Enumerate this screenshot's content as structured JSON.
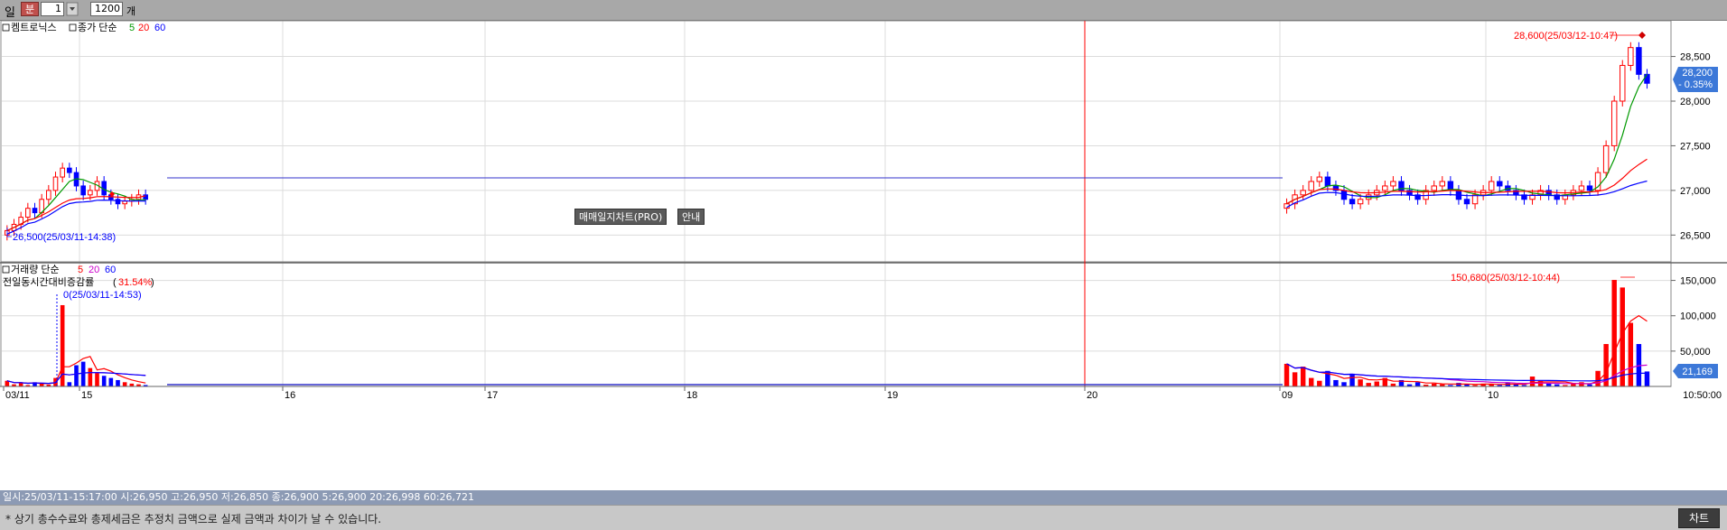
{
  "toolbar": {
    "period_day": "일",
    "period_minute": "분",
    "interval_value": "1",
    "count_value": "1200",
    "count_unit": "개"
  },
  "price_panel": {
    "stock_name": "켐트로닉스",
    "indicator_name": "종가 단순",
    "ma_periods": [
      "5",
      "20",
      "60"
    ],
    "high_marker": "28,600(25/03/12-10:47)",
    "low_marker": "26,500(25/03/11-14:38)",
    "current_price": "28,200",
    "current_change": "- 0.35%",
    "y_ticks": [
      "28,500",
      "28,000",
      "27,500",
      "27,000",
      "26,500"
    ]
  },
  "volume_panel": {
    "indicator_name": "거래량 단순",
    "ma_periods": [
      "5",
      "20",
      "60"
    ],
    "compare_label": "전일동시간대비증감률",
    "compare_value": "31.54%",
    "high_marker": "150,680(25/03/12-10:44)",
    "low_marker": "0(25/03/11-14:53)",
    "current_volume": "21,169",
    "y_ticks": [
      "150,000",
      "100,000",
      "50,000"
    ]
  },
  "x_axis": {
    "labels": [
      "03/11",
      "15",
      "16",
      "17",
      "18",
      "19",
      "20",
      "09",
      "10"
    ],
    "time_box": "10:50:00"
  },
  "overlay": {
    "chart_name": "매매일지차트(PRO)",
    "guide": "안내"
  },
  "status_bar": {
    "text": "일시:25/03/11-15:17:00 시:26,950 고:26,950 저:26,850 종:26,900 5:26,900 20:26,998 60:26,721"
  },
  "footer": {
    "notice": "* 상기 총수수료와 총제세금은 추정치 금액으로 실제 금액과 차이가 날 수 있습니다.",
    "chart_button": "차트"
  },
  "colors": {
    "up": "#ff0000",
    "down": "#0000ff",
    "ma5": "#009900",
    "ma20": "#ff0000",
    "ma60": "#0000ff",
    "price_badge": "#3c78d8"
  },
  "chart_data": [
    {
      "type": "candlestick",
      "series": [
        {
          "name": "5"
        },
        {
          "name": "20"
        },
        {
          "name": "60"
        }
      ],
      "ylim": [
        26200,
        28900
      ],
      "session_1_close_path": [
        26550,
        26620,
        26700,
        26800,
        26750,
        26900,
        27000,
        27150,
        27250,
        27200,
        27050,
        26950,
        27000,
        27100,
        26950,
        26900,
        26850,
        26880,
        26900,
        26950,
        26900
      ],
      "session_2_close_path": [
        26850,
        26950,
        27000,
        27100,
        27150,
        27050,
        27000,
        26900,
        26850,
        26900,
        26950,
        27000,
        27050,
        27100,
        27000,
        26950,
        26900,
        27000,
        27050,
        27100,
        27000,
        26900,
        26850,
        26950,
        27000,
        27100,
        27050,
        27000,
        26950,
        26900,
        26950,
        27000,
        26950,
        26900,
        26950,
        27000,
        27050,
        27000,
        27200,
        27500,
        28000,
        28400,
        28600,
        28300,
        28200
      ]
    },
    {
      "type": "bar",
      "series": [
        {
          "name": "5"
        },
        {
          "name": "20"
        },
        {
          "name": "60"
        }
      ],
      "ylim": [
        0,
        175000
      ],
      "session_1_volume": [
        8000,
        3000,
        5000,
        2000,
        6000,
        4000,
        2500,
        12000,
        115000,
        6000,
        30000,
        35000,
        26000,
        20000,
        15000,
        12000,
        9000,
        6000,
        4000,
        3000,
        2000
      ],
      "session_2_volume": [
        32000,
        20000,
        28000,
        12000,
        8000,
        22000,
        9000,
        6000,
        18000,
        10000,
        5000,
        7000,
        12000,
        4000,
        9000,
        3000,
        6000,
        2500,
        4000,
        3000,
        2000,
        5000,
        3000,
        2000,
        4000,
        3000,
        2000,
        5000,
        3000,
        2000,
        14000,
        8000,
        5000,
        3000,
        2000,
        4000,
        6000,
        3000,
        22000,
        60000,
        150680,
        140000,
        90000,
        60000,
        21169
      ]
    }
  ]
}
